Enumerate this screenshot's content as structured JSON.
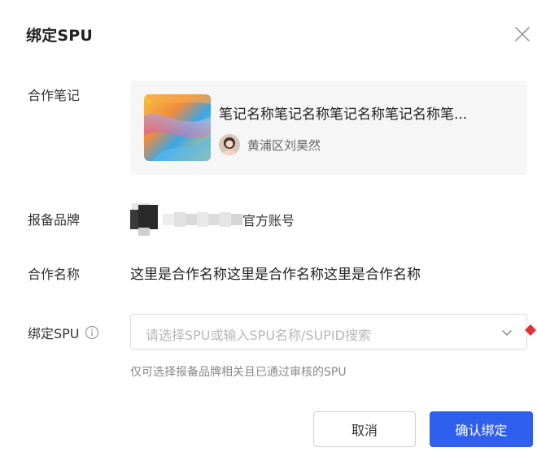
{
  "dialog": {
    "title": "绑定SPU"
  },
  "icons": {
    "close": "close-icon",
    "info": "info-icon",
    "caret": "chevron-down-icon",
    "required": "required-diamond-icon"
  },
  "fields": {
    "note": {
      "label": "合作笔记",
      "title": "笔记名称笔记名称笔记名称笔记名称笔...",
      "author": "黄浦区刘昊然"
    },
    "brand": {
      "label": "报备品牌",
      "suffix": "官方账号"
    },
    "cooperation": {
      "label": "合作名称",
      "value": "这里是合作名称这里是合作名称这里是合作名称"
    },
    "spu": {
      "label": "绑定SPU",
      "placeholder": "请选择SPU或输入SPU名称/SUPID搜索",
      "hint": "仅可选择报备品牌相关且已通过审核的SPU"
    }
  },
  "buttons": {
    "cancel": "取消",
    "confirm": "确认绑定"
  },
  "colors": {
    "primary": "#2f5fec",
    "required": "#e0303a"
  }
}
